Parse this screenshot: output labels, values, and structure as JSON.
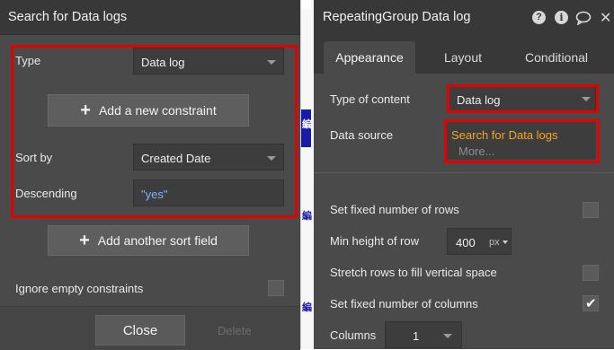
{
  "left_panel": {
    "title": "Search for Data logs",
    "type_label": "Type",
    "type_value": "Data log",
    "add_constraint_label": "Add a new constraint",
    "sort_by_label": "Sort by",
    "sort_by_value": "Created Date",
    "descending_label": "Descending",
    "descending_value": "\"yes\"",
    "add_sort_field_label": "Add another sort field",
    "ignore_empty_label": "Ignore empty constraints",
    "close_label": "Close",
    "delete_label": "Delete"
  },
  "middle_strip": {
    "glyph": "編"
  },
  "right_panel": {
    "title": "RepeatingGroup Data log",
    "tabs": [
      {
        "label": "Appearance",
        "active": true
      },
      {
        "label": "Layout",
        "active": false
      },
      {
        "label": "Conditional",
        "active": false
      }
    ],
    "type_of_content_label": "Type of content",
    "type_of_content_value": "Data log",
    "data_source_label": "Data source",
    "data_source_value": "Search for Data logs",
    "data_source_more": "More...",
    "fixed_rows_label": "Set fixed number of rows",
    "min_height_label": "Min height of row",
    "min_height_value": "400",
    "min_height_unit": "px",
    "stretch_rows_label": "Stretch rows to fill vertical space",
    "fixed_columns_label": "Set fixed number of columns",
    "fixed_columns_checked": true,
    "columns_label": "Columns",
    "columns_value": "1"
  },
  "icons": {
    "help": "question-circle-icon",
    "info": "info-circle-icon",
    "comment": "comment-icon",
    "close": "close-icon",
    "plus": "plus-icon",
    "caret": "caret-down-icon",
    "check": "checkmark-icon"
  },
  "colors": {
    "panel_bg": "#4a4a4a",
    "header_bg": "#383838",
    "highlight_red": "#e60000",
    "link_orange": "#f5a623",
    "value_blue": "#7fb2ff",
    "strip_blue": "#1a1aa8"
  }
}
